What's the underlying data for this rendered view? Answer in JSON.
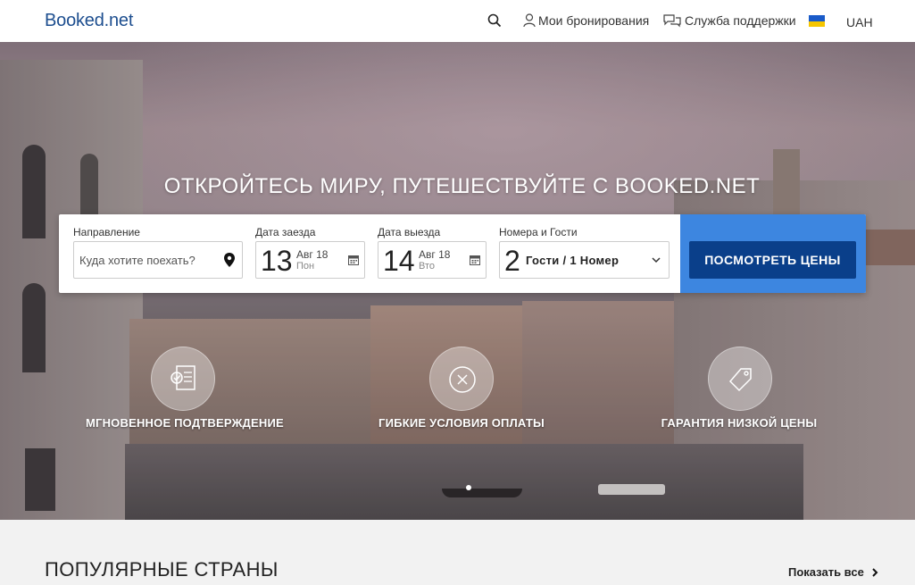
{
  "header": {
    "logo": "Booked.net",
    "bookings_label": "Мои бронирования",
    "support_label": "Служба поддержки",
    "currency": "UAH",
    "flag": "ukraine-flag"
  },
  "hero": {
    "headline": "ОТКРОЙТЕСЬ МИРУ, ПУТЕШЕСТВУЙТЕ С BOOKED.NET"
  },
  "search": {
    "destination_label": "Направление",
    "destination_placeholder": "Куда хотите поехать?",
    "checkin_label": "Дата заезда",
    "checkin_day": "13",
    "checkin_month": "Авг 18",
    "checkin_weekday": "Пон",
    "checkout_label": "Дата выезда",
    "checkout_day": "14",
    "checkout_month": "Авг 18",
    "checkout_weekday": "Вто",
    "rooms_label": "Номера и Гости",
    "guests_count": "2",
    "guests_text": "Гости / 1 Номер",
    "cta_label": "ПОСМОТРЕТЬ ЦЕНЫ"
  },
  "features": [
    {
      "label": "МГНОВЕННОЕ ПОДТВЕРЖДЕНИЕ",
      "icon": "document-check-icon"
    },
    {
      "label": "ГИБКИЕ УСЛОВИЯ ОПЛАТЫ",
      "icon": "cancel-circle-icon"
    },
    {
      "label": "ГАРАНТИЯ НИЗКОЙ ЦЕНЫ",
      "icon": "price-tag-icon"
    }
  ],
  "popular": {
    "title": "ПОПУЛЯРНЫЕ СТРАНЫ",
    "show_all": "Показать все"
  },
  "colors": {
    "brand": "#1d4e8f",
    "cta": "#0a3f8a",
    "panel": "#3d86e0"
  }
}
